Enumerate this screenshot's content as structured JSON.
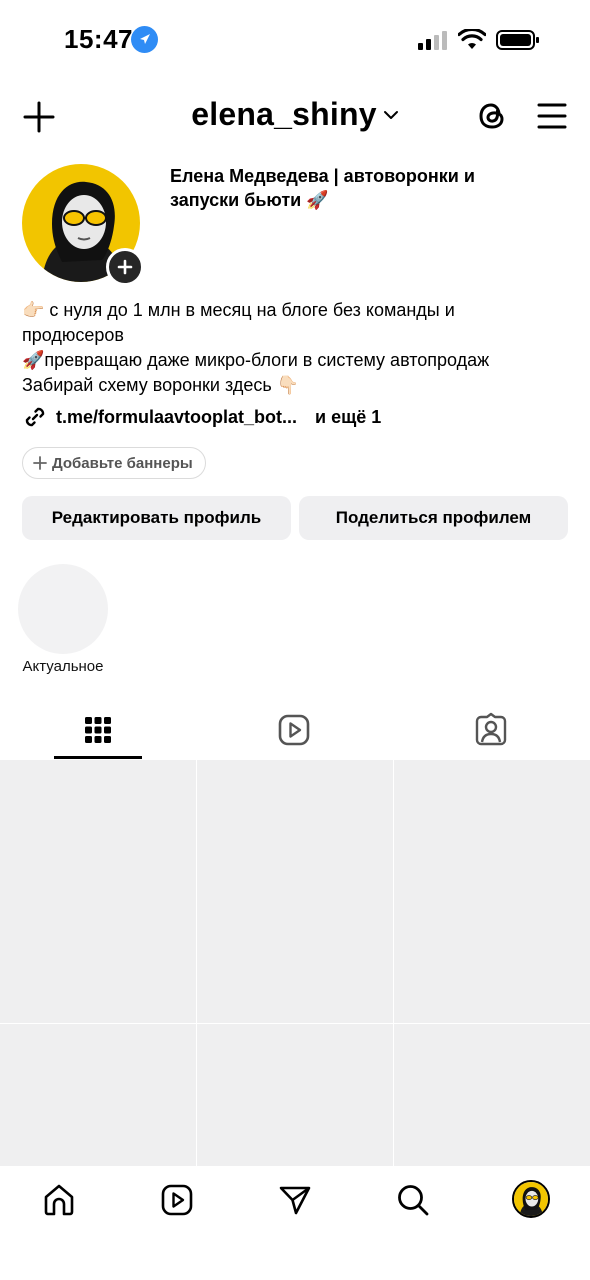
{
  "status_bar": {
    "time": "15:47"
  },
  "header": {
    "username": "elena_shiny",
    "add_icon": "plus-icon",
    "threads_icon": "threads-icon",
    "menu_icon": "hamburger-icon"
  },
  "profile": {
    "full_name": "Елена Медведева | автоворонки и запуски бьюти 🚀",
    "bio": [
      "👉🏻 с нуля до 1 млн в месяц на блоге без команды и",
      "продюсеров",
      "🚀превращаю даже микро-блоги в систему автопродаж",
      "Забирай схему воронки здесь 👇🏻"
    ],
    "link": "t.me/formulaavtooplat_bot...",
    "link_more": "и ещё 1",
    "add_banners": "Добавьте баннеры"
  },
  "actions": {
    "edit_profile": "Редактировать профиль",
    "share_profile": "Поделиться профилем"
  },
  "highlights": {
    "label": "Актуальное"
  },
  "tabs": [
    "grid-icon",
    "reels-icon",
    "tagged-icon"
  ],
  "bottom_nav": [
    "home-icon",
    "reels-icon",
    "direct-icon",
    "search-icon",
    "profile-avatar"
  ],
  "colors": {
    "accent_yellow": "#f2c500",
    "location_blue": "#2f8cf5",
    "button_bg": "#efeff1",
    "placeholder_bg": "#efeff0"
  }
}
